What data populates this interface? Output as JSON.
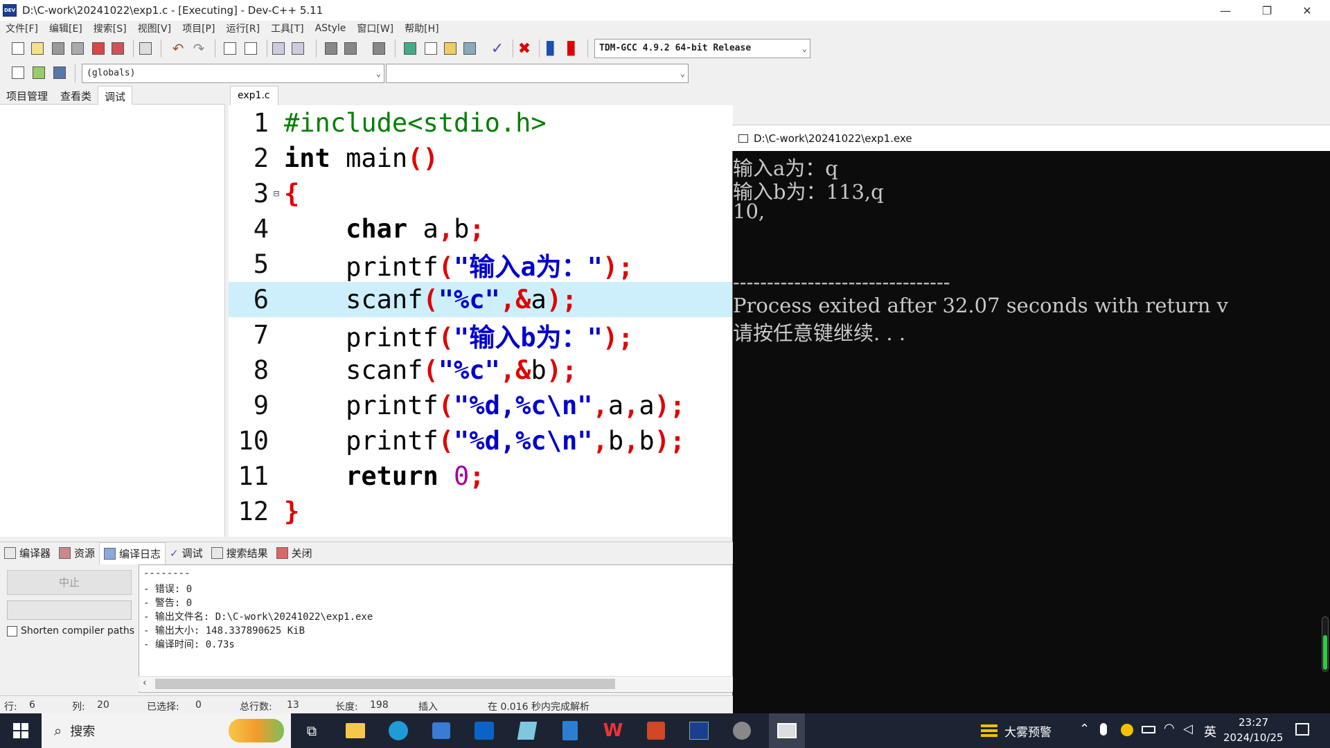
{
  "window": {
    "title": "D:\\C-work\\20241022\\exp1.c - [Executing] - Dev-C++ 5.11",
    "app_icon": "DEV",
    "minimize": "—",
    "restore": "❐",
    "close": "✕"
  },
  "menu": [
    "文件[F]",
    "编辑[E]",
    "搜索[S]",
    "视图[V]",
    "项目[P]",
    "运行[R]",
    "工具[T]",
    "AStyle",
    "窗口[W]",
    "帮助[H]"
  ],
  "toolbar": {
    "compiler_select": "TDM-GCC 4.9.2 64-bit Release",
    "scope_select": "(globals)",
    "function_select": ""
  },
  "left_tabs": [
    "项目管理",
    "查看类",
    "调试"
  ],
  "editor": {
    "file_tab": "exp1.c",
    "highlighted_line": 6,
    "fold_marker": "⊟",
    "lines": [
      {
        "n": "1",
        "tokens": [
          {
            "t": "#include<stdio.h>",
            "c": "t-pre"
          }
        ]
      },
      {
        "n": "2",
        "tokens": [
          {
            "t": "int",
            "c": "t-kw"
          },
          {
            "t": " main",
            "c": "t-id"
          },
          {
            "t": "()",
            "c": "t-sym"
          }
        ]
      },
      {
        "n": "3",
        "tokens": [
          {
            "t": "{",
            "c": "t-sym"
          }
        ]
      },
      {
        "n": "4",
        "tokens": [
          {
            "t": "    ",
            "c": "t-id"
          },
          {
            "t": "char",
            "c": "t-kw"
          },
          {
            "t": " a",
            "c": "t-id"
          },
          {
            "t": ",",
            "c": "t-sym"
          },
          {
            "t": "b",
            "c": "t-id"
          },
          {
            "t": ";",
            "c": "t-sym"
          }
        ]
      },
      {
        "n": "5",
        "tokens": [
          {
            "t": "    printf",
            "c": "t-id"
          },
          {
            "t": "(",
            "c": "t-sym"
          },
          {
            "t": "\"输入a为：\"",
            "c": "t-str"
          },
          {
            "t": ");",
            "c": "t-sym"
          }
        ]
      },
      {
        "n": "6",
        "tokens": [
          {
            "t": "    scanf",
            "c": "t-id"
          },
          {
            "t": "(",
            "c": "t-sym"
          },
          {
            "t": "\"%c\"",
            "c": "t-str"
          },
          {
            "t": ",&",
            "c": "t-sym"
          },
          {
            "t": "a",
            "c": "t-id"
          },
          {
            "t": ");",
            "c": "t-sym"
          }
        ]
      },
      {
        "n": "7",
        "tokens": [
          {
            "t": "    printf",
            "c": "t-id"
          },
          {
            "t": "(",
            "c": "t-sym"
          },
          {
            "t": "\"输入b为：\"",
            "c": "t-str"
          },
          {
            "t": ");",
            "c": "t-sym"
          }
        ]
      },
      {
        "n": "8",
        "tokens": [
          {
            "t": "    scanf",
            "c": "t-id"
          },
          {
            "t": "(",
            "c": "t-sym"
          },
          {
            "t": "\"%c\"",
            "c": "t-str"
          },
          {
            "t": ",&",
            "c": "t-sym"
          },
          {
            "t": "b",
            "c": "t-id"
          },
          {
            "t": ");",
            "c": "t-sym"
          }
        ]
      },
      {
        "n": "9",
        "tokens": [
          {
            "t": "    printf",
            "c": "t-id"
          },
          {
            "t": "(",
            "c": "t-sym"
          },
          {
            "t": "\"%d,%c\\n\"",
            "c": "t-str"
          },
          {
            "t": ",",
            "c": "t-sym"
          },
          {
            "t": "a",
            "c": "t-id"
          },
          {
            "t": ",",
            "c": "t-sym"
          },
          {
            "t": "a",
            "c": "t-id"
          },
          {
            "t": ");",
            "c": "t-sym"
          }
        ]
      },
      {
        "n": "10",
        "tokens": [
          {
            "t": "    printf",
            "c": "t-id"
          },
          {
            "t": "(",
            "c": "t-sym"
          },
          {
            "t": "\"%d,%c\\n\"",
            "c": "t-str"
          },
          {
            "t": ",",
            "c": "t-sym"
          },
          {
            "t": "b",
            "c": "t-id"
          },
          {
            "t": ",",
            "c": "t-sym"
          },
          {
            "t": "b",
            "c": "t-id"
          },
          {
            "t": ");",
            "c": "t-sym"
          }
        ]
      },
      {
        "n": "11",
        "tokens": [
          {
            "t": "    ",
            "c": "t-id"
          },
          {
            "t": "return",
            "c": "t-kw"
          },
          {
            "t": " ",
            "c": "t-id"
          },
          {
            "t": "0",
            "c": "t-num"
          },
          {
            "t": ";",
            "c": "t-sym"
          }
        ]
      },
      {
        "n": "12",
        "tokens": [
          {
            "t": "}",
            "c": "t-sym"
          }
        ]
      }
    ]
  },
  "console": {
    "title": "D:\\C-work\\20241022\\exp1.exe",
    "lines": [
      "输入a为：q",
      "输入b为：113,q",
      "10,",
      "",
      "",
      "--------------------------------",
      "Process exited after 32.07 seconds with return v",
      "请按任意键继续. . ."
    ]
  },
  "bottom_tabs": [
    "编译器",
    "资源",
    "编译日志",
    "调试",
    "搜索结果",
    "关闭"
  ],
  "bottom_left": {
    "stop_button": "中止",
    "shorten_paths_label": "Shorten compiler paths"
  },
  "compile_log": [
    "--------",
    "- 错误: 0",
    "- 警告: 0",
    "- 输出文件名: D:\\C-work\\20241022\\exp1.exe",
    "- 输出大小: 148.337890625 KiB",
    "- 编译时间: 0.73s"
  ],
  "status": {
    "row_label": "行:",
    "row_value": "6",
    "col_label": "列:",
    "col_value": "20",
    "sel_label": "已选择:",
    "sel_value": "0",
    "total_label": "总行数:",
    "total_value": "13",
    "len_label": "长度:",
    "len_value": "198",
    "mode": "插入",
    "parse": "在 0.016 秒内完成解析"
  },
  "taskbar": {
    "search_label": "搜索",
    "weather": "大雾预警",
    "ime": "英",
    "time": "23:27",
    "date": "2024/10/25"
  }
}
